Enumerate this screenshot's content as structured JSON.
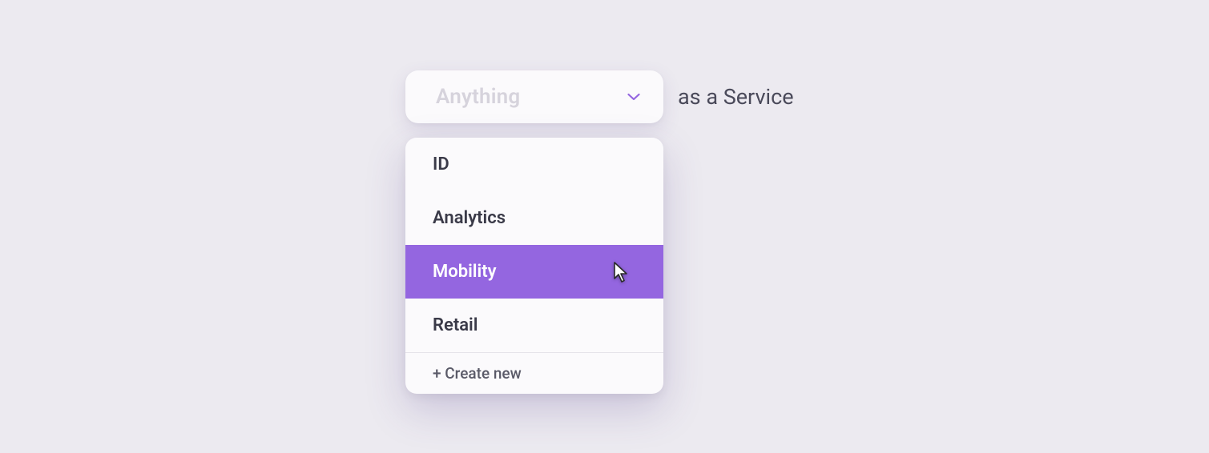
{
  "dropdown": {
    "placeholder": "Anything",
    "suffix_label": "as a Service",
    "items": [
      {
        "label": "ID",
        "hovered": false
      },
      {
        "label": "Analytics",
        "hovered": false
      },
      {
        "label": "Mobility",
        "hovered": true
      },
      {
        "label": "Retail",
        "hovered": false
      }
    ],
    "create_label": "+ Create new"
  },
  "colors": {
    "accent": "#9466e0",
    "background": "#eceaf0",
    "surface": "#fbfafc",
    "text": "#3a3a48",
    "placeholder": "#d6d3dc"
  }
}
